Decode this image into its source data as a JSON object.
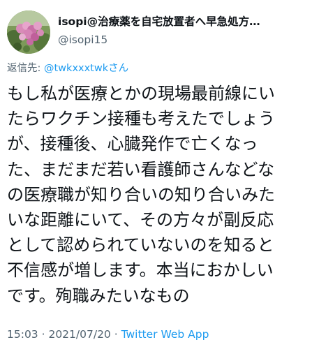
{
  "tweet": {
    "author": {
      "display_name": "isopi@治療薬を自宅放置者へ早急処方…",
      "handle": "@isopi15",
      "avatar": "flower-photo-avatar"
    },
    "reply_to": {
      "label": "返信先:",
      "mention": "@twkxxxtwk",
      "suffix": "さん"
    },
    "body_lines": [
      "もし私が医療とかの現場最前線にい",
      "たらワクチン接種も考えたでしょう",
      "が、接種後、心臓発作で亡くなっ",
      "た、まだまだ若い看護師さんなどな",
      "の医療職が知り合いの知り合いみた",
      "いな距離にいて、その方々が副反応",
      "として認められていないのを知ると",
      "不信感が増します。本当におかしい",
      "です。殉職みたいなもの"
    ],
    "meta": {
      "time": "15:03",
      "separator1": " · ",
      "date": "2021/07/20",
      "separator2": " · ",
      "source": "Twitter Web App"
    }
  },
  "colors": {
    "text_primary": "#0f1419",
    "text_secondary": "#536471",
    "link": "#1d9bf0"
  }
}
